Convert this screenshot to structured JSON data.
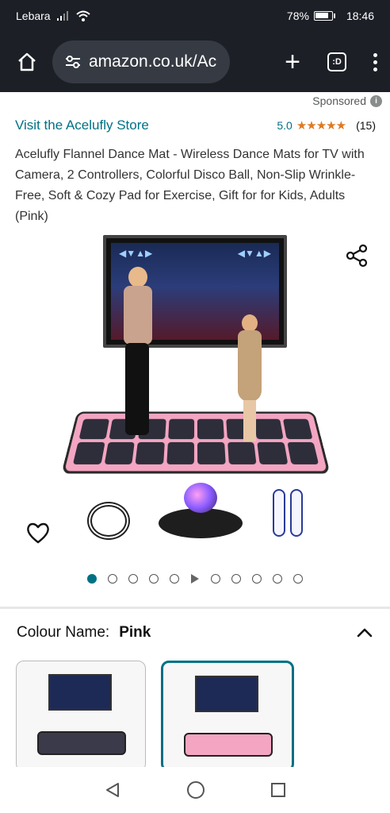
{
  "status_bar": {
    "carrier": "Lebara",
    "battery": "78%",
    "time": "18:46"
  },
  "browser": {
    "url": "amazon.co.uk/Acı",
    "tab_label": ":D"
  },
  "ad": {
    "sponsored_label": "Sponsored",
    "store_link": "Visit the Acelufly Store",
    "rating_value": "5.0",
    "stars": "★★★★★",
    "rating_count": "(15)",
    "title": "Acelufly Flannel Dance Mat - Wireless Dance Mats for TV with Camera, 2 Controllers, Colorful Disco Ball, Non-Slip Wrinkle-Free, Soft & Cozy Pad for Exercise, Gift for for Kids, Adults (Pink)"
  },
  "gallery": {
    "image_count": 11,
    "active_index": 0
  },
  "variation": {
    "label": "Colour Name:",
    "value": "Pink",
    "options_selected": 1
  },
  "colors": {
    "accent": "#007185",
    "star": "#de7921",
    "dark_bar": "#1c1f26"
  }
}
